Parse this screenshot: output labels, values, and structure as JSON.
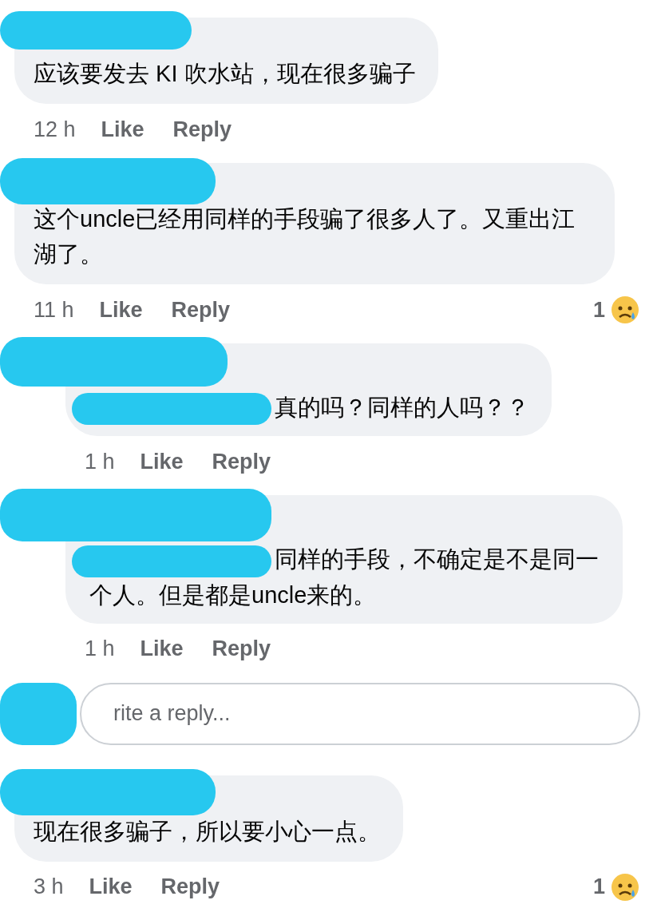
{
  "comments": [
    {
      "text": "应该要发去 KI 吹水站，现在很多骗子",
      "time": "12 h",
      "actions": [
        "Like",
        "Reply"
      ]
    },
    {
      "text": "这个uncle已经用同样的手段骗了很多人了。又重出江湖了。",
      "time": "11 h",
      "actions": [
        "Like",
        "Reply"
      ],
      "reaction_count": "1",
      "replies": [
        {
          "text": "真的吗？同样的人吗？？",
          "mention_redacted": true,
          "time": "1 h",
          "actions": [
            "Like",
            "Reply"
          ]
        },
        {
          "text": "同样的手段，不确定是不是同一个人。但是都是uncle来的。",
          "mention_redacted": true,
          "time": "1 h",
          "actions": [
            "Like",
            "Reply"
          ]
        }
      ],
      "reply_field": {
        "placeholder": "rite a reply..."
      }
    },
    {
      "text": "现在很多骗子，所以要小心一点。",
      "time": "3 h",
      "actions": [
        "Like",
        "Reply"
      ],
      "reaction_count": "1"
    }
  ]
}
